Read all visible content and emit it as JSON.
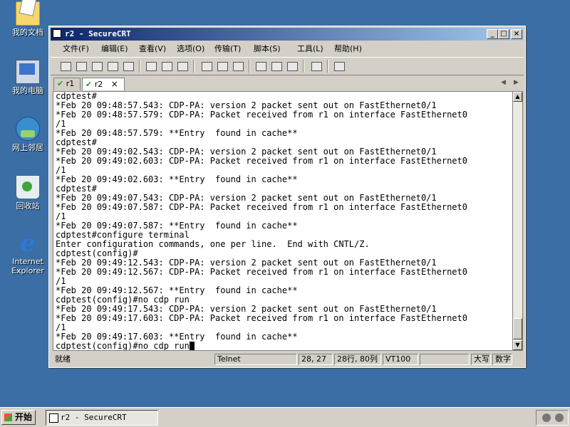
{
  "desktop": {
    "icons": [
      {
        "label": "我的文档",
        "icon": "my-documents-icon"
      },
      {
        "label": "我的电脑",
        "icon": "my-computer-icon"
      },
      {
        "label": "网上邻居",
        "icon": "network-places-icon"
      },
      {
        "label": "回收站",
        "icon": "recycle-bin-icon"
      },
      {
        "label": "Internet Explorer",
        "icon": "internet-explorer-icon",
        "label_line1": "Internet",
        "label_line2": "Explorer"
      }
    ]
  },
  "window": {
    "title": "r2 - SecureCRT",
    "buttons": {
      "minimize": "_",
      "maximize": "□",
      "close": "×"
    },
    "menu": [
      "文件(F)",
      "编辑(E)",
      "查看(V)",
      "选项(O)",
      "传输(T)",
      "脚本(S)",
      "工具(L)",
      "帮助(H)"
    ],
    "tabs": [
      {
        "label": "r1",
        "active": false
      },
      {
        "label": "r2",
        "active": true,
        "close": "×"
      }
    ],
    "tab_nav": {
      "left": "◀",
      "right": "▶"
    },
    "terminal_lines": [
      "cdptest#",
      "*Feb 20 09:48:57.543: CDP-PA: version 2 packet sent out on FastEthernet0/1",
      "*Feb 20 09:48:57.579: CDP-PA: Packet received from r1 on interface FastEthernet0",
      "/1",
      "*Feb 20 09:48:57.579: **Entry  found in cache**",
      "cdptest#",
      "*Feb 20 09:49:02.543: CDP-PA: version 2 packet sent out on FastEthernet0/1",
      "*Feb 20 09:49:02.603: CDP-PA: Packet received from r1 on interface FastEthernet0",
      "/1",
      "*Feb 20 09:49:02.603: **Entry  found in cache**",
      "cdptest#",
      "*Feb 20 09:49:07.543: CDP-PA: version 2 packet sent out on FastEthernet0/1",
      "*Feb 20 09:49:07.587: CDP-PA: Packet received from r1 on interface FastEthernet0",
      "/1",
      "*Feb 20 09:49:07.587: **Entry  found in cache**",
      "cdptest#configure terminal",
      "Enter configuration commands, one per line.  End with CNTL/Z.",
      "cdptest(config)#",
      "*Feb 20 09:49:12.543: CDP-PA: version 2 packet sent out on FastEthernet0/1",
      "*Feb 20 09:49:12.567: CDP-PA: Packet received from r1 on interface FastEthernet0",
      "/1",
      "*Feb 20 09:49:12.567: **Entry  found in cache**",
      "cdptest(config)#no cdp run",
      "*Feb 20 09:49:17.543: CDP-PA: version 2 packet sent out on FastEthernet0/1",
      "*Feb 20 09:49:17.603: CDP-PA: Packet received from r1 on interface FastEthernet0",
      "/1",
      "*Feb 20 09:49:17.603: **Entry  found in cache**"
    ],
    "prompt_line": "cdptest(config)#no cdp run",
    "scroll": {
      "up": "▲",
      "down": "▼"
    },
    "status": {
      "ready": "就绪",
      "protocol": "Telnet",
      "position": "28, 27",
      "size": "28行, 80列",
      "terminal": "VT100",
      "caps": "大写",
      "num": "数字"
    }
  },
  "taskbar": {
    "start_label": "开始",
    "task_title": "r2 - SecureCRT"
  }
}
